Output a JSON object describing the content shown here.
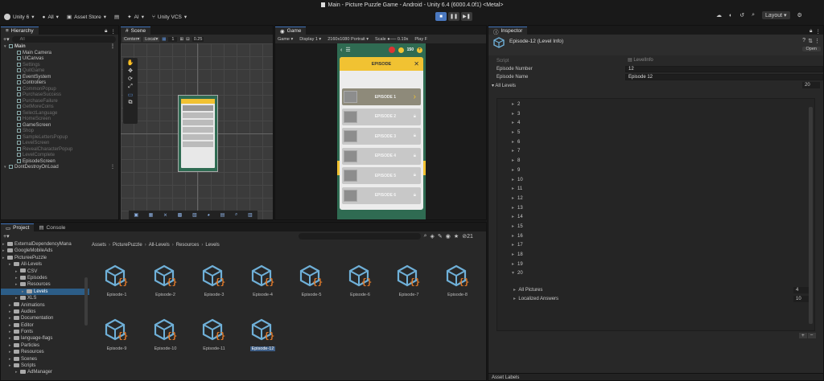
{
  "window_title": "Main - Picture Puzzle Game - Android - Unity 6.4 (6000.4.0f1) <Metal>",
  "toolbar": {
    "account": "Unity 6",
    "all": "All",
    "asset_store": "Asset Store",
    "ai": "AI",
    "vcs": "Unity VCS",
    "layout": "Layout"
  },
  "hierarchy": {
    "tab": "Hierarchy",
    "search_placeholder": "All",
    "items": [
      {
        "label": "Main",
        "indent": 0,
        "bold": true,
        "dim": false
      },
      {
        "label": "Main Camera",
        "indent": 1,
        "dim": false
      },
      {
        "label": "UICanvas",
        "indent": 1,
        "dim": false
      },
      {
        "label": "Settings",
        "indent": 1,
        "dim": true
      },
      {
        "label": "QuitGame",
        "indent": 1,
        "dim": true
      },
      {
        "label": "EventSystem",
        "indent": 1,
        "dim": false
      },
      {
        "label": "Controllers",
        "indent": 1,
        "dim": false
      },
      {
        "label": "CommonPopup",
        "indent": 1,
        "dim": true
      },
      {
        "label": "PurchaseSuccess",
        "indent": 1,
        "dim": true
      },
      {
        "label": "PurchaseFailure",
        "indent": 1,
        "dim": true
      },
      {
        "label": "GetMoreCoins",
        "indent": 1,
        "dim": true
      },
      {
        "label": "SelectLanguage",
        "indent": 1,
        "dim": true
      },
      {
        "label": "HomeScreen",
        "indent": 1,
        "dim": true
      },
      {
        "label": "GameScreen",
        "indent": 1,
        "dim": false
      },
      {
        "label": "Shop",
        "indent": 1,
        "dim": true
      },
      {
        "label": "SampleLettersPopup",
        "indent": 1,
        "dim": true
      },
      {
        "label": "LevelScreen",
        "indent": 1,
        "dim": true
      },
      {
        "label": "RevealCharacterPopup",
        "indent": 1,
        "dim": true
      },
      {
        "label": "LevelComplete",
        "indent": 1,
        "dim": true
      },
      {
        "label": "EpisodeScreen",
        "indent": 1,
        "dim": false
      },
      {
        "label": "DontDestroyOnLoad",
        "indent": 0,
        "dim": false
      }
    ]
  },
  "scene": {
    "tab": "Scene",
    "pivot": "Center",
    "space": "Local",
    "grid": "1",
    "scale": "0.25"
  },
  "game": {
    "tab": "Game",
    "display_menu": "Game",
    "display": "Display 1",
    "resolution": "2160x1080 Portrait",
    "scale_label": "Scale",
    "scale_value": "0.19x",
    "play_focused": "Play F",
    "coins": "150",
    "header": "EPISODE",
    "episodes": [
      "EPISODE 1",
      "EPISODE 2",
      "EPISODE 3",
      "EPISODE 4",
      "EPISODE 5",
      "EPISODE 6"
    ]
  },
  "project": {
    "tabs": [
      "Project",
      "Console"
    ],
    "badge": "21",
    "tree": [
      {
        "label": "ExternalDependencyMana",
        "indent": 1
      },
      {
        "label": "GoogleMobileAds",
        "indent": 1
      },
      {
        "label": "PictureePuzzle",
        "indent": 1
      },
      {
        "label": "All-Levels",
        "indent": 2
      },
      {
        "label": "CSV",
        "indent": 3
      },
      {
        "label": "Episodes",
        "indent": 3
      },
      {
        "label": "Resources",
        "indent": 3
      },
      {
        "label": "Levels",
        "indent": 4,
        "sel": true
      },
      {
        "label": "XLS",
        "indent": 3
      },
      {
        "label": "Animations",
        "indent": 2
      },
      {
        "label": "Audios",
        "indent": 2
      },
      {
        "label": "Documentation",
        "indent": 2
      },
      {
        "label": "Editor",
        "indent": 2
      },
      {
        "label": "Fonts",
        "indent": 2
      },
      {
        "label": "language-flags",
        "indent": 2
      },
      {
        "label": "Particles",
        "indent": 2
      },
      {
        "label": "Resources",
        "indent": 2
      },
      {
        "label": "Scenes",
        "indent": 2
      },
      {
        "label": "Scripts",
        "indent": 2
      },
      {
        "label": "AdManager",
        "indent": 3
      }
    ],
    "breadcrumb": [
      "Assets",
      "PicturePuzzle",
      "All-Levels",
      "Resources",
      "Levels"
    ],
    "assets": [
      "Episode-1",
      "Episode-2",
      "Episode-3",
      "Episode-4",
      "Episode-5",
      "Episode-6",
      "Episode-7",
      "Episode-8",
      "Episode-9",
      "Episode-10",
      "Episode-11",
      "Episode-12"
    ]
  },
  "inspector": {
    "tab": "Inspector",
    "object_title": "Episode-12 (Level Info)",
    "open": "Open",
    "script_label": "Script",
    "script_value": "LevelInfo",
    "fields": [
      {
        "label": "Episode Number",
        "value": "12"
      },
      {
        "label": "Episode Name",
        "value": "Episode 12"
      }
    ],
    "all_levels_label": "All Levels",
    "all_levels_count": "20",
    "levels": [
      "2",
      "3",
      "4",
      "5",
      "6",
      "7",
      "8",
      "9",
      "10",
      "11",
      "12",
      "13",
      "14",
      "15",
      "16",
      "17",
      "18",
      "19",
      "20"
    ],
    "sub_fields": [
      {
        "label": "All Pictures",
        "value": "4"
      },
      {
        "label": "Localized Answers",
        "value": "10"
      }
    ],
    "asset_labels": "Asset Labels"
  }
}
